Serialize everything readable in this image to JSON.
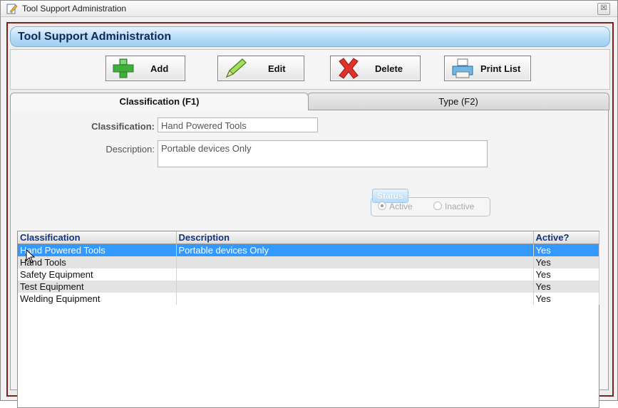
{
  "window": {
    "title": "Tool Support Administration",
    "close_glyph": "☒"
  },
  "header": {
    "title": "Tool Support Administration"
  },
  "toolbar": {
    "add_label": "Add",
    "edit_label": "Edit",
    "delete_label": "Delete",
    "print_label": "Print List"
  },
  "tabs": [
    {
      "label": "Classification (F1)",
      "active": true
    },
    {
      "label": "Type (F2)",
      "active": false
    }
  ],
  "form": {
    "classification_label": "Classification:",
    "classification_value": "Hand Powered Tools",
    "description_label": "Description:",
    "description_value": "Portable devices Only"
  },
  "status": {
    "legend": "Status",
    "active_label": "Active",
    "inactive_label": "Inactive",
    "selected": "Active"
  },
  "grid": {
    "columns": [
      "Classification",
      "Description",
      "Active?"
    ],
    "rows": [
      {
        "classification": "Hand Powered Tools",
        "description": "Portable devices Only",
        "active": "Yes",
        "selected": true
      },
      {
        "classification": "Hand Tools",
        "description": "",
        "active": "Yes"
      },
      {
        "classification": "Safety Equipment",
        "description": "",
        "active": "Yes"
      },
      {
        "classification": "Test Equipment",
        "description": "",
        "active": "Yes"
      },
      {
        "classification": "Welding Equipment",
        "description": "",
        "active": "Yes"
      }
    ]
  },
  "colors": {
    "selection": "#3399ff",
    "frame": "#7a2320",
    "header_text": "#0f2a54",
    "grid_header_text": "#15317a"
  }
}
